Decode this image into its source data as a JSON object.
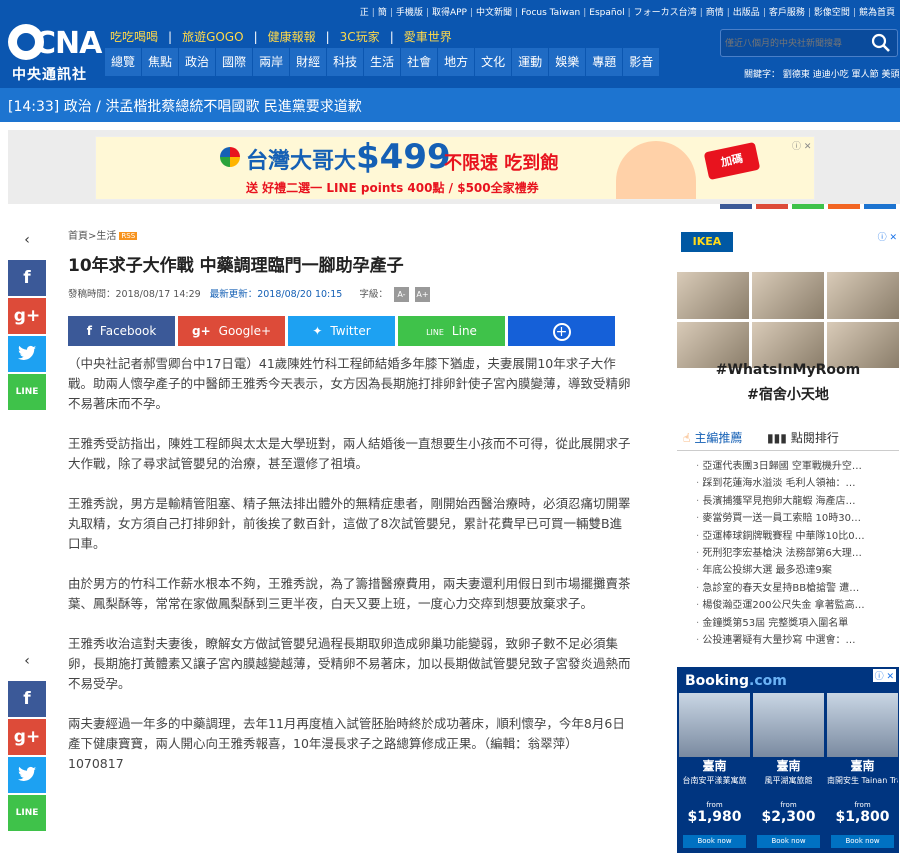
{
  "header": {
    "top_links": [
      "正",
      "簡",
      "手機版",
      "取得APP",
      "中文新聞",
      "Focus Taiwan",
      "Español",
      "フォーカス台湾",
      "商情",
      "出版品",
      "客戶服務",
      "影像空間",
      "競為首頁"
    ],
    "logo_abbr": "CNA",
    "logo_name": "中央通訊社",
    "sub_links": [
      "吃吃喝喝",
      "旅遊GOGO",
      "健康報報",
      "3C玩家",
      "愛車世界"
    ],
    "nav": [
      "總覽",
      "焦點",
      "政治",
      "國際",
      "兩岸",
      "財經",
      "科技",
      "生活",
      "社會",
      "地方",
      "文化",
      "運動",
      "娛樂",
      "專題",
      "影音"
    ],
    "search_placeholder": "僅近八個月的中央社新聞搜尋",
    "hot_keywords": "關鍵字：   劉德東  迪迪小吃  軍人節  美頭"
  },
  "ticker": {
    "text": "[14:33] 政治 / 洪孟楷批蔡總統不唱國歌 民進黨要求道歉"
  },
  "ad_banner": {
    "brand": "台灣大哥大",
    "price": "$499",
    "unlimited": "不限速 吃到飽",
    "promo": "送 好禮二選一 LINE points 400點 / $500全家禮券",
    "stamp": "加碼"
  },
  "article": {
    "breadcrumb": "首頁>生活",
    "rss": "RSS",
    "title": "10年求子大作戰 中藥調理臨門一腳助孕產子",
    "published": "發稿時間：2018/08/17 14:29",
    "updated": "最新更新：2018/08/20 10:15",
    "font_size_label": "字級：",
    "font_minus": "A-",
    "font_plus": "A+",
    "share": {
      "facebook": "Facebook",
      "google": "Google+",
      "twitter": "Twitter",
      "line": "Line",
      "more": "+"
    },
    "paragraphs": [
      "（中央社記者郝雪卿台中17日電）41歲陳姓竹科工程師結婚多年膝下猶虛，夫妻展開10年求子大作戰。助兩人懷孕產子的中醫師王雅秀今天表示，女方因為長期施打排卵針使子宮內膜變薄，導致受精卵不易著床而不孕。",
      "王雅秀受訪指出，陳姓工程師與太太是大學班對，兩人結婚後一直想要生小孩而不可得，從此展開求子大作戰，除了尋求試管嬰兒的治療，甚至還修了祖墳。",
      "王雅秀說，男方是輸精管阻塞、精子無法排出體外的無精症患者，剛開始西醫治療時，必須忍痛切開睪丸取精，女方須自己打排卵針，前後挨了數百針，這做了8次試管嬰兒，累計花費早已可買一輛雙B進口車。",
      "由於男方的竹科工作薪水根本不夠，王雅秀說，為了籌措醫療費用，兩夫妻還利用假日到市場擺攤賣茶葉、鳳梨酥等，常常在家做鳳梨酥到三更半夜，白天又要上班，一度心力交瘁到想要放棄求子。",
      "王雅秀收治這對夫妻後，瞭解女方做試管嬰兒過程長期取卵造成卵巢功能變弱，致卵子數不足必須集卵，長期施打黃體素又讓子宮內膜越變越薄，受精卵不易著床，加以長期做試管嬰兒致子宮發炎過熱而不易受孕。",
      "兩夫妻經過一年多的中藥調理，去年11月再度植入試管胚胎時終於成功著床，順利懷孕，今年8月6日產下健康寶寶，兩人開心向王雅秀報喜，10年漫長求子之路總算修成正果。（編輯：翁翠萍）1070817"
    ]
  },
  "left_rail": {
    "collapse": "‹",
    "facebook": "f",
    "google": "g+",
    "line": "LINE"
  },
  "right_ad": {
    "brand": "IKEA",
    "line1": "#WhatsInMyRoom",
    "line2": "#宿舍小天地",
    "ad_icon": "ⓘ ✕"
  },
  "popular": {
    "tab_recommend": "主編推薦",
    "tab_clicks": "點閱排行",
    "items": [
      "亞運代表團3日歸國 空軍戰機升空…",
      "踩到花蓮海水溢淡 毛利人領袖：…",
      "長濱捕獲罕見抱卵大龍蝦 海產店…",
      "麥當勞買一送一員工索賠 10時30…",
      "亞運棒球銅牌戰賽程 中華隊10比0…",
      "死刑犯李宏基槍決 法務部第6大理…",
      "年底公投綁大選 最多恐達9案",
      "急診室的春天女星持BB槍搶警 遭…",
      "楊俊瀚亞運200公尺失金 拿著監高…",
      "金鐘獎第53屆 完整獎項入圍名單",
      "公投連署疑有大量抄寫 中選會：…"
    ]
  },
  "booking": {
    "brand_a": "Booking",
    "brand_b": ".com",
    "ad_icon": "ⓘ ✕",
    "hotels": [
      {
        "city": "臺南",
        "hotel": "台南安平漾業寓旅",
        "from": "from",
        "price": "$1,980",
        "button": "Book now"
      },
      {
        "city": "臺南",
        "hotel": "風平湖寓旅館",
        "from": "from",
        "price": "$2,300",
        "button": "Book now"
      },
      {
        "city": "臺南",
        "hotel": "南開安生 Tainan Travel Inn",
        "from": "from",
        "price": "$1,800",
        "button": "Book now"
      }
    ]
  },
  "colors": {
    "brand_blue": "#0b56b0",
    "ticker_blue": "#1d74d0",
    "facebook": "#3b5998",
    "google": "#dd4b39",
    "twitter": "#1da1f2",
    "line": "#3fc24a",
    "booking_navy": "#003580"
  }
}
